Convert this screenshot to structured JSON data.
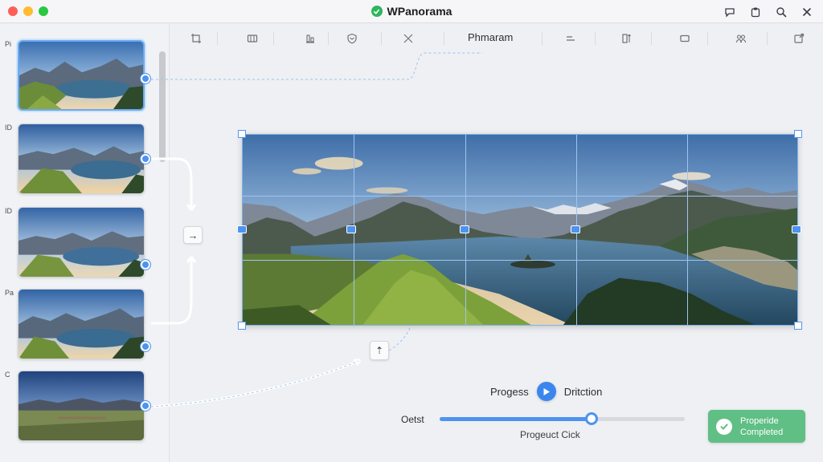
{
  "window": {
    "title": "WPanorama",
    "controls": [
      "close",
      "minimize",
      "maximize"
    ],
    "right_icons": [
      "chat-icon",
      "clipboard-icon",
      "search-icon",
      "close-icon"
    ]
  },
  "toolbar": {
    "title": "Phmaram",
    "tools": [
      "crop-icon",
      "layers-icon",
      "align-icon",
      "shield-icon",
      "transform-icon",
      "distribute-icon",
      "split-icon",
      "frame-icon",
      "people-icon",
      "export-icon"
    ]
  },
  "sidebar": {
    "thumbnails": [
      {
        "label": "Pi",
        "selected": true
      },
      {
        "label": "ID",
        "selected": false
      },
      {
        "label": "ID",
        "selected": false
      },
      {
        "label": "Pa",
        "selected": false
      },
      {
        "label": "C",
        "selected": false
      }
    ]
  },
  "connectors": {
    "merge_button_glyph": "→",
    "move_button_glyph": "⇡"
  },
  "progress": {
    "label": "Progess",
    "direction_label": "Dritction",
    "slider_label": "Oetst",
    "slider_value": 0.62,
    "slider_caption": "Progeuct Cick"
  },
  "status_badge": {
    "line1": "Properide",
    "line2": "Completed"
  },
  "colors": {
    "accent": "#4d93f0",
    "success": "#5fbf85",
    "window_bg": "#eef0f3"
  }
}
